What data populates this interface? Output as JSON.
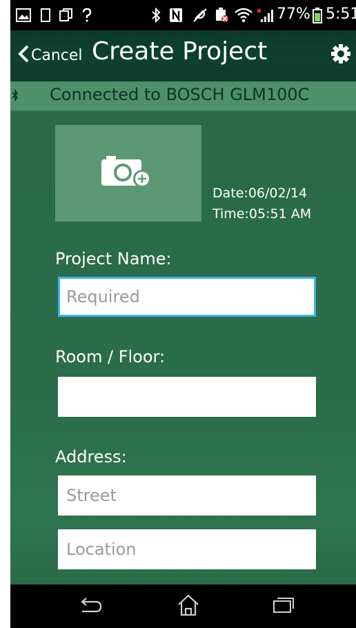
{
  "status_bar": {
    "icons": [
      "image-icon",
      "device-icon",
      "copy-icon",
      "question-icon",
      "bluetooth-icon",
      "nfc-icon",
      "mute-icon",
      "battery-saver-icon",
      "wifi-icon",
      "signal-icon"
    ],
    "battery_level": "77%",
    "time": "5:51"
  },
  "header": {
    "back_label": "Cancel",
    "title": "Create Project"
  },
  "connection": {
    "text": "Connected to BOSCH GLM100C"
  },
  "photo": {
    "date": "Date:06/02/14",
    "time": "Time:05:51 AM"
  },
  "form": {
    "project_name_label": "Project Name:",
    "project_name_placeholder": "Required",
    "project_name_value": "",
    "room_label": "Room / Floor:",
    "room_value": "",
    "address_label": "Address:",
    "street_placeholder": "Street",
    "location_placeholder": "Location"
  },
  "colors": {
    "background": "#2a6a48",
    "header": "#0d3a2c",
    "connection_bar": "#4e9069",
    "focus_border": "#3fb6e8"
  }
}
